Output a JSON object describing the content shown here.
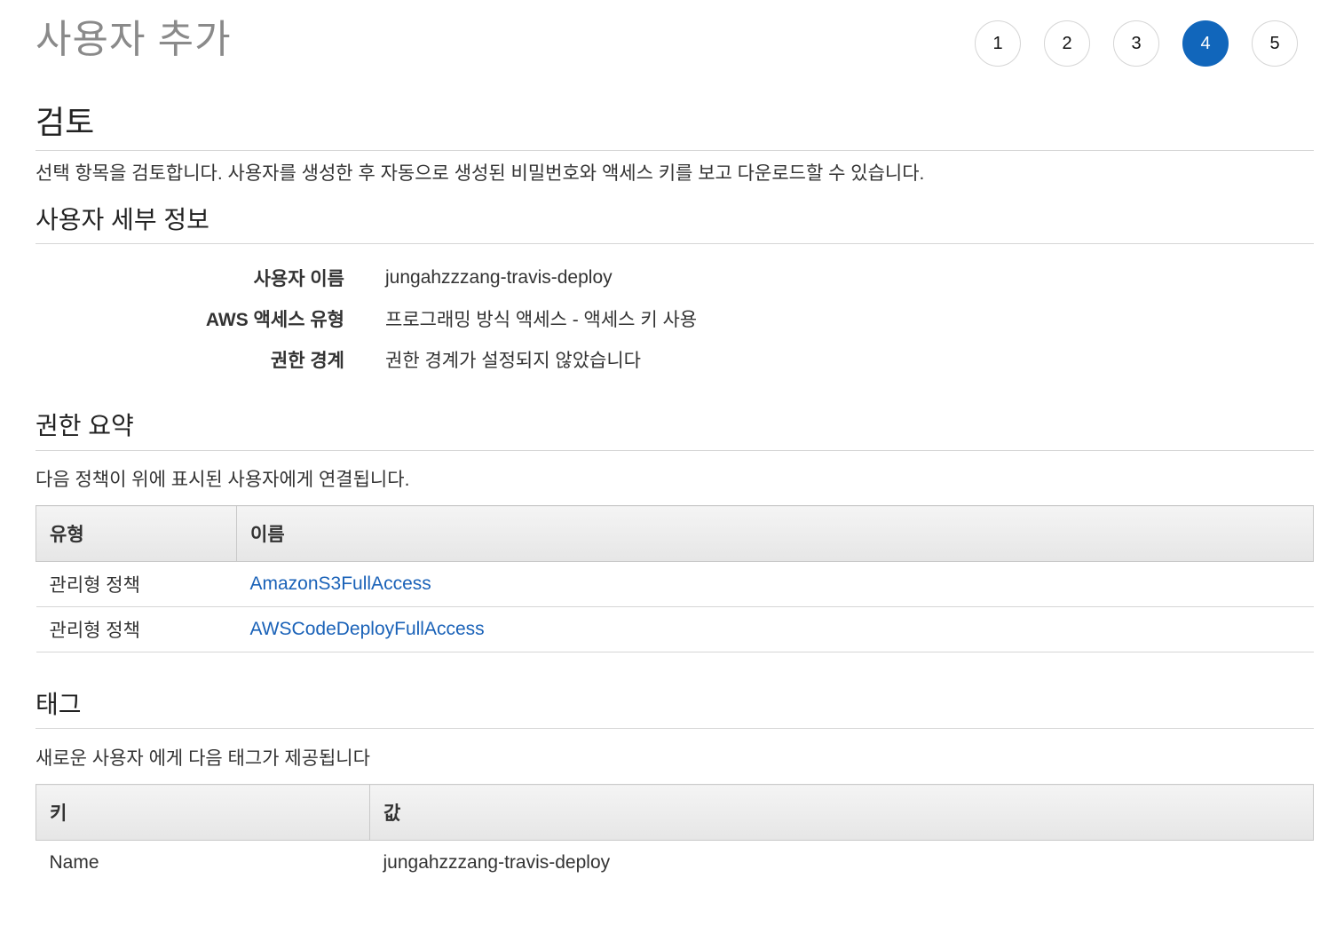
{
  "page_title": "사용자 추가",
  "steps": [
    "1",
    "2",
    "3",
    "4",
    "5"
  ],
  "active_step": "4",
  "review": {
    "heading": "검토",
    "description": "선택 항목을 검토합니다. 사용자를 생성한 후 자동으로 생성된 비밀번호와 액세스 키를 보고 다운로드할 수 있습니다."
  },
  "user_details": {
    "heading": "사용자 세부 정보",
    "rows": [
      {
        "label": "사용자 이름",
        "value": "jungahzzzang-travis-deploy"
      },
      {
        "label": "AWS 액세스 유형",
        "value": "프로그래밍 방식 액세스 - 액세스 키 사용"
      },
      {
        "label": "권한 경계",
        "value": "권한 경계가 설정되지 않았습니다"
      }
    ]
  },
  "permissions": {
    "heading": "권한 요약",
    "description": "다음 정책이 위에 표시된 사용자에게 연결됩니다.",
    "columns": [
      "유형",
      "이름"
    ],
    "rows": [
      {
        "type": "관리형 정책",
        "name": "AmazonS3FullAccess"
      },
      {
        "type": "관리형 정책",
        "name": "AWSCodeDeployFullAccess"
      }
    ]
  },
  "tags": {
    "heading": "태그",
    "description": "새로운 사용자 에게 다음 태그가 제공됩니다",
    "columns": [
      "키",
      "값"
    ],
    "rows": [
      {
        "key": "Name",
        "value": "jungahzzzang-travis-deploy"
      }
    ]
  },
  "colors": {
    "accent": "#1166bb",
    "link": "#1a62b8",
    "title_gray": "#8a8a8a"
  }
}
